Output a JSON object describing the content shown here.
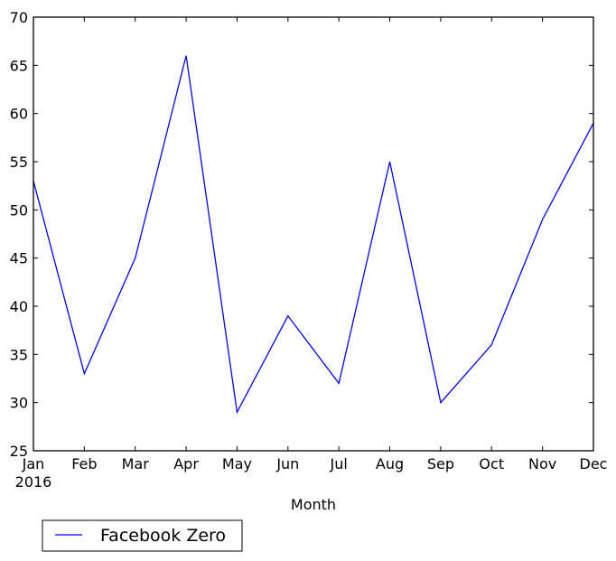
{
  "chart_data": {
    "type": "line",
    "title": "",
    "xlabel": "Month",
    "ylabel": "",
    "categories": [
      "Jan",
      "Feb",
      "Mar",
      "Apr",
      "May",
      "Jun",
      "Jul",
      "Aug",
      "Sep",
      "Oct",
      "Nov",
      "Dec"
    ],
    "x_tick_labels": [
      "Jan\n2016",
      "Feb",
      "Mar",
      "Apr",
      "May",
      "Jun",
      "Jul",
      "Aug",
      "Sep",
      "Oct",
      "Nov",
      "Dec"
    ],
    "year_label": "2016",
    "series": [
      {
        "name": "Facebook Zero",
        "color": "#0000ff",
        "values": [
          53,
          33,
          45,
          66,
          29,
          39,
          32,
          55,
          30,
          36,
          49,
          59
        ]
      }
    ],
    "ylim": [
      25,
      70
    ],
    "y_ticks": [
      25,
      30,
      35,
      40,
      45,
      50,
      55,
      60,
      65,
      70
    ],
    "grid": false,
    "legend": {
      "placement": "bottom-left, below plot",
      "entries": [
        "Facebook Zero"
      ]
    }
  }
}
